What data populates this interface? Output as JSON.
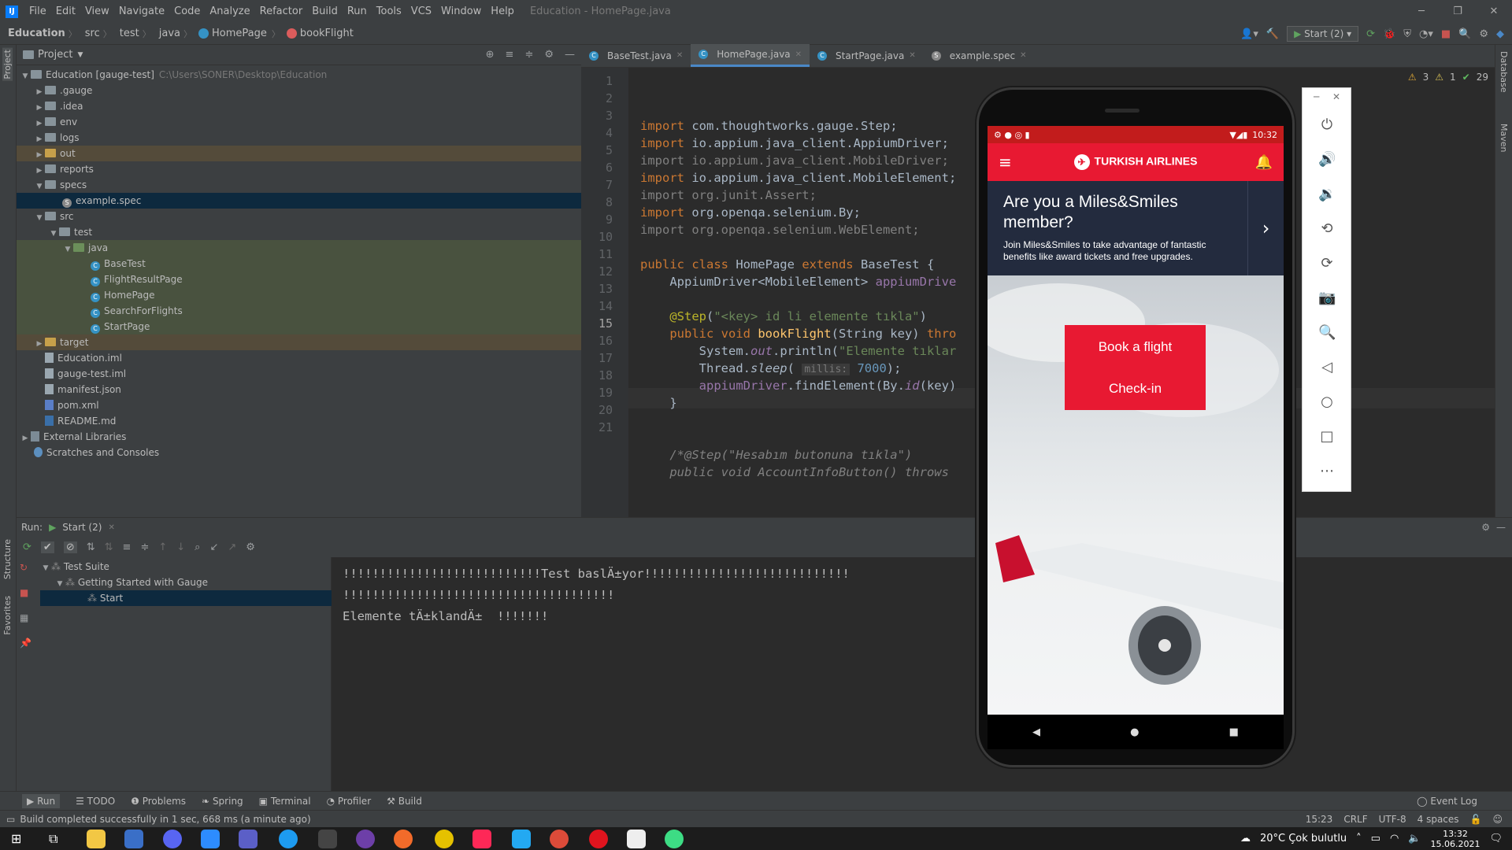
{
  "menubar": {
    "logo": "IJ",
    "items": [
      "File",
      "Edit",
      "View",
      "Navigate",
      "Code",
      "Analyze",
      "Refactor",
      "Build",
      "Run",
      "Tools",
      "VCS",
      "Window",
      "Help"
    ],
    "window_title": "Education - HomePage.java"
  },
  "navbar": {
    "crumbs": [
      "Education",
      "src",
      "test",
      "java",
      "HomePage",
      "bookFlight"
    ],
    "run_config": "Start (2)"
  },
  "project": {
    "header": "Project",
    "root_label": "Education [gauge-test]",
    "root_path": "C:\\Users\\SONER\\Desktop\\Education",
    "items": [
      ".gauge",
      ".idea",
      "env",
      "logs",
      "out",
      "reports",
      "specs",
      "example.spec",
      "src",
      "test",
      "java",
      "BaseTest",
      "FlightResultPage",
      "HomePage",
      "SearchForFlights",
      "StartPage",
      "target",
      "Education.iml",
      "gauge-test.iml",
      "manifest.json",
      "pom.xml",
      "README.md",
      "External Libraries",
      "Scratches and Consoles"
    ]
  },
  "tabs": [
    "BaseTest.java",
    "HomePage.java",
    "StartPage.java",
    "example.spec"
  ],
  "inspections": {
    "warnings": "3",
    "weak": "1",
    "ok": "29"
  },
  "code": {
    "line_numbers": [
      "1",
      "2",
      "3",
      "4",
      "5",
      "6",
      "7",
      "8",
      "9",
      "10",
      "11",
      "12",
      "13",
      "14",
      "15",
      "16",
      "17",
      "18",
      "19",
      "20",
      "21"
    ],
    "l1_kw": "import",
    "l1": " com.thoughtworks.gauge.Step;",
    "l2_kw": "import",
    "l2": " io.appium.java_client.AppiumDriver;",
    "l3": "import io.appium.java_client.MobileDriver;",
    "l4_kw": "import",
    "l4": " io.appium.java_client.MobileElement;",
    "l5": "import org.junit.Assert;",
    "l6_kw": "import",
    "l6": " org.openqa.selenium.By;",
    "l7": "import org.openqa.selenium.WebElement;",
    "l9_kw": "public class",
    "l9": " HomePage ",
    "l9_kw2": "extends",
    "l9b": " BaseTest {",
    "l10": "    AppiumDriver<MobileElement> ",
    "l10_f": "appiumDrive",
    "l12_a": "    @Step",
    "l12_p": "(",
    "l12_s": "\"<key> id li elemente tıkla\"",
    "l12_e": ")",
    "l13_kw": "    public void ",
    "l13_fn": "bookFlight",
    "l13_b": "(String key) ",
    "l13_kw2": "thro",
    "l14_a": "        System.",
    "l14_f": "out",
    "l14_b": ".println(",
    "l14_s": "\"Elemente tıklar",
    "l15_a": "        Thread.",
    "l15_i": "sleep",
    "l15_b": "( ",
    "l15_h": "millis:",
    "l15_n": " 7000",
    "l15_c": ");",
    "l16_a": "        ",
    "l16_f": "appiumDriver",
    "l16_b": ".findElement(By.",
    "l16_i": "id",
    "l16_c": "(key)",
    "l17": "    }",
    "l20": "    /*@Step(\"Hesabım butonuna tıkla\")",
    "l21": "    public void AccountInfoButton() throws"
  },
  "run": {
    "label": "Run:",
    "config": "Start (2)",
    "tree": [
      "Test Suite",
      "Getting Started with Gauge",
      "Start"
    ],
    "console": [
      "!!!!!!!!!!!!!!!!!!!!!!!!!!!Test baslÄ±yor!!!!!!!!!!!!!!!!!!!!!!!!!!!!",
      "!!!!!!!!!!!!!!!!!!!!!!!!!!!!!!!!!!!!!",
      "Elemente tÄ±klandÄ±  !!!!!!!"
    ]
  },
  "bottom_tools": [
    "Run",
    "TODO",
    "Problems",
    "Spring",
    "Terminal",
    "Profiler",
    "Build",
    "Event Log"
  ],
  "status": {
    "message": "Build completed successfully in 1 sec, 668 ms (a minute ago)",
    "position": "15:23",
    "line_sep": "CRLF",
    "encoding": "UTF-8",
    "indent": "4 spaces"
  },
  "side_labels": {
    "left": [
      "Project",
      "Structure",
      "Favorites"
    ],
    "right": [
      "Database",
      "Maven"
    ]
  },
  "phone": {
    "time": "10:32",
    "brand": "TURKISH AIRLINES",
    "promo_title": "Are you a Miles&Smiles member?",
    "promo_text": "Join Miles&Smiles to take advantage of fantastic benefits like award tickets and free upgrades.",
    "book_button": "Book a flight",
    "checkin_button": "Check-in"
  },
  "taskbar": {
    "weather": "20°C  Çok bulutlu",
    "time": "13:32",
    "date": "15.06.2021"
  },
  "colors": {
    "accent": "#e81932",
    "ide_bg": "#2b2b2b",
    "panel": "#3c3f41"
  }
}
